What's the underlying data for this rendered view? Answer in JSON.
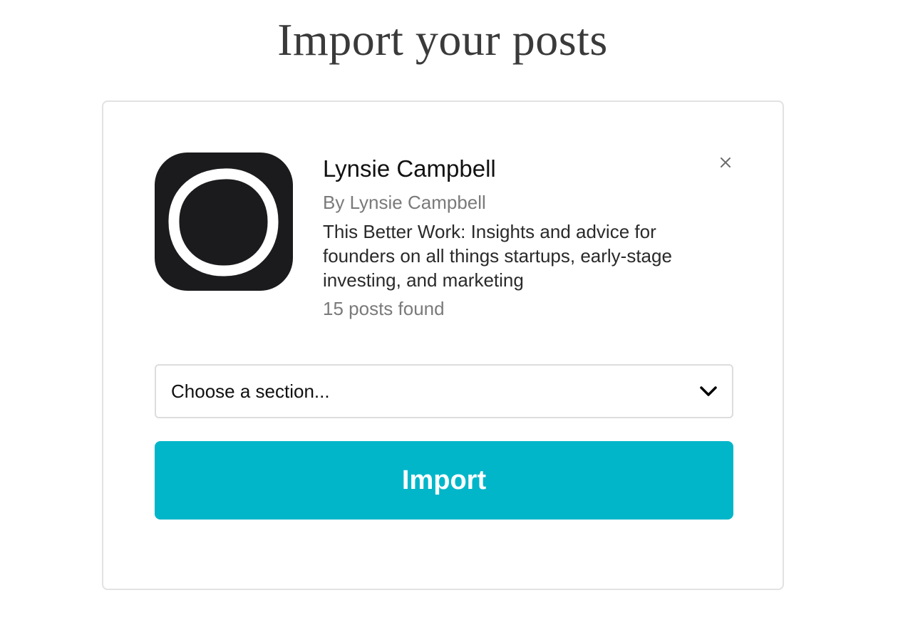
{
  "page": {
    "title": "Import your posts"
  },
  "publication": {
    "name": "Lynsie Campbell",
    "author": "By Lynsie Campbell",
    "description": "This Better Work: Insights and advice for founders on all things startups, early-stage investing, and marketing",
    "posts_found": "15 posts found",
    "logo_icon": "ring-logo-icon"
  },
  "section_select": {
    "value": "Choose a section...",
    "icon": "chevron-down-icon"
  },
  "actions": {
    "import_label": "Import",
    "close_icon": "close-icon"
  },
  "colors": {
    "accent": "#02b6c9",
    "logo_bg": "#1b1b1d",
    "title_text": "#3a3a3a",
    "muted_text": "#7a7a7a",
    "border": "#e2e2e2"
  }
}
